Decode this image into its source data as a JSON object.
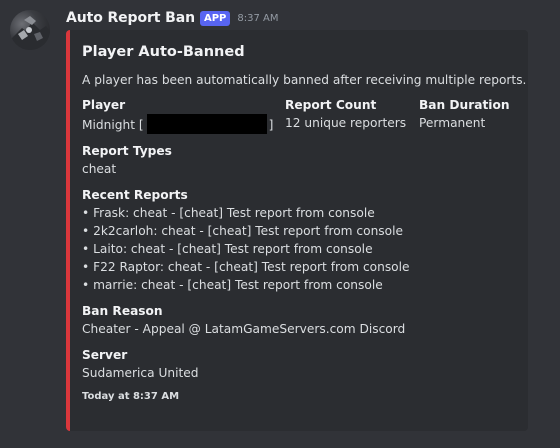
{
  "message": {
    "author": "Auto Report Ban",
    "badge": "APP",
    "timestamp": "8:37 AM"
  },
  "embed": {
    "accent_color": "#da373c",
    "title": "Player Auto-Banned",
    "description": "A player has been automatically banned after receiving multiple reports.",
    "inline_fields": [
      {
        "name": "Player",
        "value_prefix": "Midnight [",
        "value_suffix": "]"
      },
      {
        "name": "Report Count",
        "value": "12 unique reporters"
      },
      {
        "name": "Ban Duration",
        "value": "Permanent"
      }
    ],
    "report_types": {
      "name": "Report Types",
      "value": "cheat"
    },
    "recent_reports": {
      "name": "Recent Reports",
      "items": [
        "• Frask: cheat - [cheat] Test report from console",
        "• 2k2carloh: cheat - [cheat] Test report from console",
        "• Laito: cheat - [cheat] Test report from console",
        "• F22 Raptor: cheat - [cheat] Test report from console",
        "• marrie: cheat - [cheat] Test report from console"
      ]
    },
    "ban_reason": {
      "name": "Ban Reason",
      "value": "Cheater - Appeal @ LatamGameServers.com Discord"
    },
    "server": {
      "name": "Server",
      "value": "Sudamerica United"
    },
    "footer": "Today at 8:37 AM"
  }
}
